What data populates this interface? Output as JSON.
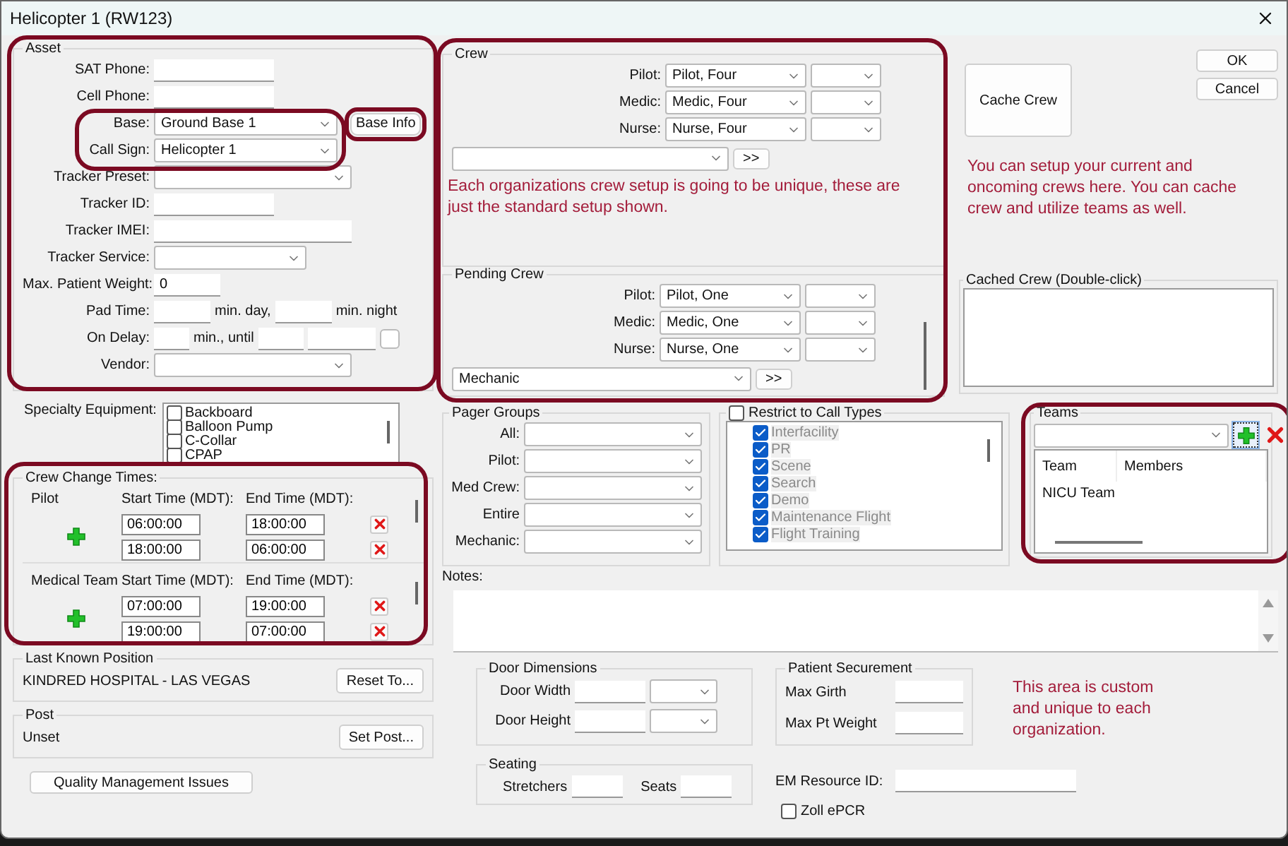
{
  "window": {
    "title": "Helicopter 1 (RW123)"
  },
  "asset": {
    "title": "Asset",
    "rows": [
      {
        "label": "SAT Phone:",
        "parts": [
          {
            "kind": "text"
          }
        ]
      },
      {
        "label": "Cell Phone:",
        "parts": [
          {
            "kind": "text"
          }
        ]
      },
      {
        "label": "Base:",
        "parts": [
          {
            "kind": "select",
            "value": "Ground Base 1"
          },
          {
            "kind": "button",
            "label": "Base Info"
          }
        ]
      },
      {
        "label": "Call Sign:",
        "parts": [
          {
            "kind": "select",
            "value": "Helicopter 1"
          }
        ]
      },
      {
        "label": "Tracker Preset:",
        "parts": [
          {
            "kind": "select"
          }
        ]
      },
      {
        "label": "Tracker ID:",
        "parts": [
          {
            "kind": "text"
          }
        ]
      },
      {
        "label": "Tracker IMEI:",
        "parts": [
          {
            "kind": "text"
          }
        ]
      },
      {
        "label": "Tracker Service:",
        "parts": [
          {
            "kind": "select"
          }
        ]
      },
      {
        "label": "Max. Patient Weight:",
        "parts": [
          {
            "kind": "text",
            "value": "0"
          }
        ]
      },
      {
        "label": "Pad Time:",
        "parts": [
          {
            "kind": "text"
          },
          {
            "kind": "suffix",
            "text": "min. day,"
          },
          {
            "kind": "text"
          },
          {
            "kind": "suffix",
            "text": "min. night"
          }
        ]
      },
      {
        "label": "On Delay:",
        "parts": [
          {
            "kind": "text"
          },
          {
            "kind": "suffix",
            "text": "min., until"
          },
          {
            "kind": "text"
          },
          {
            "kind": "text"
          },
          {
            "kind": "box"
          }
        ]
      },
      {
        "label": "Vendor:",
        "parts": [
          {
            "kind": "select"
          }
        ]
      }
    ]
  },
  "crew": {
    "title": "Crew",
    "rows": [
      {
        "label": "Pilot:",
        "value": "Pilot, Four"
      },
      {
        "label": "Medic:",
        "value": "Medic, Four"
      },
      {
        "label": "Nurse:",
        "value": "Nurse, Four"
      }
    ],
    "move_button": ">>"
  },
  "crew_note": "Each organizations crew setup is going to be unique, these are just the standard setup shown.",
  "pending_crew": {
    "title": "Pending Crew",
    "rows": [
      {
        "label": "Pilot:",
        "value": "Pilot, One"
      },
      {
        "label": "Medic:",
        "value": "Medic, One"
      },
      {
        "label": "Nurse:",
        "value": "Nurse, One"
      }
    ],
    "extra_value": "Mechanic",
    "move_button": ">>"
  },
  "actions": {
    "cache": "Cache Crew",
    "ok": "OK",
    "cancel": "Cancel"
  },
  "right_note": "You can setup your current and oncoming crews here. You can cache crew and utilize teams as well.",
  "cached_crew": {
    "title": "Cached Crew (Double-click)"
  },
  "specialty": {
    "label": "Specialty Equipment:",
    "items": [
      {
        "label": "Backboard",
        "checked": false
      },
      {
        "label": "Balloon Pump",
        "checked": false
      },
      {
        "label": "C-Collar",
        "checked": false
      },
      {
        "label": "CPAP",
        "checked": false
      }
    ]
  },
  "crew_change": {
    "title": "Crew Change Times:",
    "groups": [
      {
        "name": "Pilot",
        "start_header": "Start Time (MDT):",
        "end_header": "End Time (MDT):",
        "rows": [
          {
            "start": "06:00:00",
            "end": "18:00:00"
          },
          {
            "start": "18:00:00",
            "end": "06:00:00"
          }
        ]
      },
      {
        "name": "Medical Team",
        "start_header": "Start Time (MDT):",
        "end_header": "End Time (MDT):",
        "rows": [
          {
            "start": "07:00:00",
            "end": "19:00:00"
          },
          {
            "start": "19:00:00",
            "end": "07:00:00"
          }
        ]
      }
    ]
  },
  "last_position": {
    "title": "Last Known Position",
    "value": "KINDRED HOSPITAL - LAS VEGAS",
    "button": "Reset To..."
  },
  "post": {
    "title": "Post",
    "value": "Unset",
    "button": "Set Post..."
  },
  "quality_button": "Quality Management Issues",
  "pager_groups": {
    "title": "Pager Groups",
    "rows": [
      "All:",
      "Pilot:",
      "Med Crew:",
      "Entire",
      "Mechanic:"
    ]
  },
  "call_types": {
    "label": "Restrict to Call Types",
    "checked": false,
    "items": [
      {
        "label": "Interfacility",
        "checked": true
      },
      {
        "label": "PR",
        "checked": true
      },
      {
        "label": "Scene",
        "checked": true
      },
      {
        "label": "Search",
        "checked": true
      },
      {
        "label": "Demo",
        "checked": true
      },
      {
        "label": "Maintenance Flight",
        "checked": true
      },
      {
        "label": "Flight Training",
        "checked": true
      }
    ]
  },
  "teams": {
    "title": "Teams",
    "columns": [
      "Team",
      "Members"
    ],
    "rows": [
      {
        "team": "NICU Team"
      }
    ]
  },
  "notes": {
    "label": "Notes:"
  },
  "door": {
    "title": "Door Dimensions",
    "rows": [
      "Door Width",
      "Door Height"
    ]
  },
  "securement": {
    "title": "Patient Securement",
    "rows": [
      "Max Girth",
      "Max Pt Weight"
    ]
  },
  "seating": {
    "title": "Seating",
    "fields": [
      "Stretchers",
      "Seats"
    ]
  },
  "em_resource": {
    "label": "EM Resource ID:"
  },
  "zoll": {
    "label": "Zoll ePCR",
    "checked": false
  },
  "bottom_note": "This area is custom and unique to each organization."
}
